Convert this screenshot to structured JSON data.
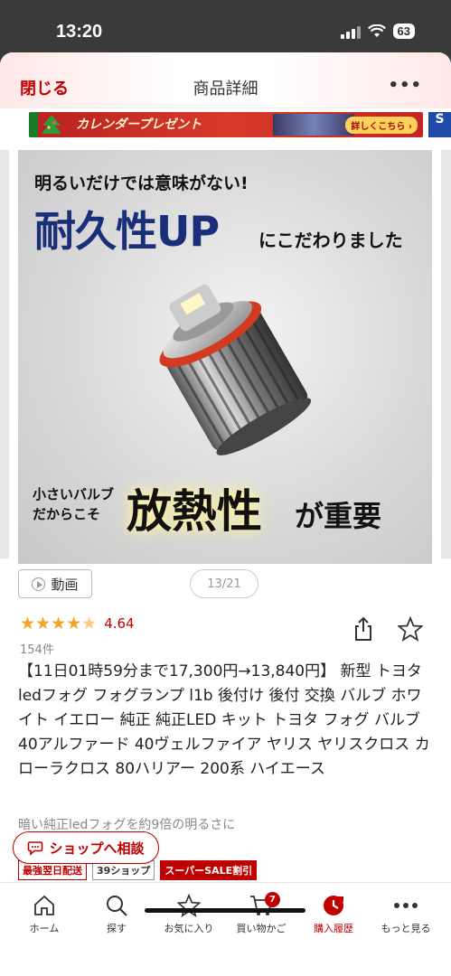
{
  "status_bar": {
    "time": "13:20",
    "battery": "63"
  },
  "header": {
    "close_label": "閉じる",
    "title": "商品詳細",
    "more_label": "•••"
  },
  "banner": {
    "text": "カレンダープレゼント",
    "detail_label": "詳しくこちら ›",
    "right_text": "S"
  },
  "product_image": {
    "line1": "明るいだけでは意味がない!",
    "big": "耐久性UP",
    "sub": "にこだわりました",
    "small": "小さいバルブ だからこそ",
    "heat": "放熱性",
    "heat2": "が重要"
  },
  "media": {
    "video_label": "動画",
    "page_counter": "13/21"
  },
  "rating": {
    "stars": "★★★★★",
    "value": "4.64",
    "count": "154件"
  },
  "product": {
    "title": "【11日01時59分まで17,300円→13,840円】 新型 トヨタ ledフォグ フォグランプ l1b 後付け 後付 交換 バルブ ホワイト イエロー 純正 純正LED キット トヨタ フォグ バルブ 40アルファード 40ヴェルファイア ヤリス ヤリスクロス カローラクロス 80ハリアー 200系 ハイエース",
    "subtext": "暗い純正ledフォグを約9倍の明るさに"
  },
  "consult_label": "ショップへ相談",
  "badges": [
    "最強翌日配送",
    "39ショップ",
    "スーパーSALE割引"
  ],
  "bottom_nav": [
    {
      "label": "ホーム",
      "icon": "home-icon"
    },
    {
      "label": "探す",
      "icon": "search-icon"
    },
    {
      "label": "お気に入り",
      "icon": "star-icon"
    },
    {
      "label": "買い物かご",
      "icon": "cart-icon",
      "badge": "7"
    },
    {
      "label": "購入履歴",
      "icon": "history-icon",
      "active": true
    },
    {
      "label": "もっと見る",
      "icon": "more-icon"
    }
  ],
  "colors": {
    "accent": "#bf0000",
    "star": "#f4a425",
    "title_blue": "#1a2f7a"
  }
}
